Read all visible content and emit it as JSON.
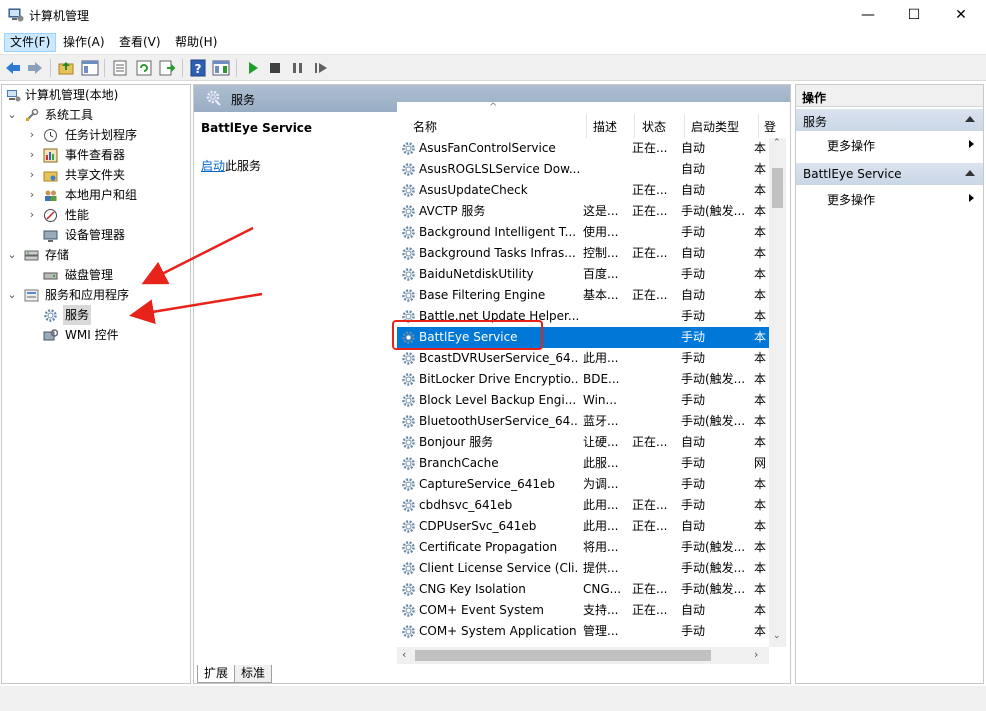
{
  "window": {
    "title": "计算机管理",
    "minimize": "—",
    "maximize": "☐",
    "close": "✕"
  },
  "menubar": {
    "items": [
      "文件(F)",
      "操作(A)",
      "查看(V)",
      "帮助(H)"
    ]
  },
  "tree": {
    "root": "计算机管理(本地)",
    "items": [
      {
        "label": "系统工具",
        "icon": "tools-icon"
      },
      {
        "label": "任务计划程序",
        "icon": "clock-icon"
      },
      {
        "label": "事件查看器",
        "icon": "event-viewer-icon"
      },
      {
        "label": "共享文件夹",
        "icon": "shared-folder-icon"
      },
      {
        "label": "本地用户和组",
        "icon": "users-icon"
      },
      {
        "label": "性能",
        "icon": "performance-icon"
      },
      {
        "label": "设备管理器",
        "icon": "device-manager-icon"
      },
      {
        "label": "存储",
        "icon": "storage-icon"
      },
      {
        "label": "磁盘管理",
        "icon": "disk-icon"
      },
      {
        "label": "服务和应用程序",
        "icon": "services-apps-icon"
      },
      {
        "label": "服务",
        "icon": "gear-icon"
      },
      {
        "label": "WMI 控件",
        "icon": "wmi-icon"
      }
    ]
  },
  "middle": {
    "header": "服务",
    "detail": {
      "service_name": "BattlEye Service",
      "start_link": "启动",
      "start_suffix": "此服务"
    },
    "columns": [
      "名称",
      "描述",
      "状态",
      "启动类型",
      "登"
    ],
    "rows": [
      {
        "name": "AsusFanControlService",
        "desc": "",
        "status": "正在...",
        "startup": "自动",
        "logon": "本"
      },
      {
        "name": "AsusROGLSLService Dow...",
        "desc": "",
        "status": "",
        "startup": "自动",
        "logon": "本"
      },
      {
        "name": "AsusUpdateCheck",
        "desc": "",
        "status": "正在...",
        "startup": "自动",
        "logon": "本"
      },
      {
        "name": "AVCTP 服务",
        "desc": "这是...",
        "status": "正在...",
        "startup": "手动(触发...",
        "logon": "本"
      },
      {
        "name": "Background Intelligent T...",
        "desc": "使用...",
        "status": "",
        "startup": "手动",
        "logon": "本"
      },
      {
        "name": "Background Tasks Infras...",
        "desc": "控制...",
        "status": "正在...",
        "startup": "自动",
        "logon": "本"
      },
      {
        "name": "BaiduNetdiskUtility",
        "desc": "百度...",
        "status": "",
        "startup": "手动",
        "logon": "本"
      },
      {
        "name": "Base Filtering Engine",
        "desc": "基本...",
        "status": "正在...",
        "startup": "自动",
        "logon": "本"
      },
      {
        "name": "Battle.net Update Helper...",
        "desc": "",
        "status": "",
        "startup": "手动",
        "logon": "本"
      },
      {
        "name": "BattlEye Service",
        "desc": "",
        "status": "",
        "startup": "手动",
        "logon": "本"
      },
      {
        "name": "BcastDVRUserService_64...",
        "desc": "此用...",
        "status": "",
        "startup": "手动",
        "logon": "本"
      },
      {
        "name": "BitLocker Drive Encryptio...",
        "desc": "BDE...",
        "status": "",
        "startup": "手动(触发...",
        "logon": "本"
      },
      {
        "name": "Block Level Backup Engi...",
        "desc": "Win...",
        "status": "",
        "startup": "手动",
        "logon": "本"
      },
      {
        "name": "BluetoothUserService_64...",
        "desc": "蓝牙...",
        "status": "",
        "startup": "手动(触发...",
        "logon": "本"
      },
      {
        "name": "Bonjour 服务",
        "desc": "让硬...",
        "status": "正在...",
        "startup": "自动",
        "logon": "本"
      },
      {
        "name": "BranchCache",
        "desc": "此服...",
        "status": "",
        "startup": "手动",
        "logon": "网"
      },
      {
        "name": "CaptureService_641eb",
        "desc": "为调...",
        "status": "",
        "startup": "手动",
        "logon": "本"
      },
      {
        "name": "cbdhsvc_641eb",
        "desc": "此用...",
        "status": "正在...",
        "startup": "手动",
        "logon": "本"
      },
      {
        "name": "CDPUserSvc_641eb",
        "desc": "此用...",
        "status": "正在...",
        "startup": "自动",
        "logon": "本"
      },
      {
        "name": "Certificate Propagation",
        "desc": "将用...",
        "status": "",
        "startup": "手动(触发...",
        "logon": "本"
      },
      {
        "name": "Client License Service (Cli...",
        "desc": "提供...",
        "status": "",
        "startup": "手动(触发...",
        "logon": "本"
      },
      {
        "name": "CNG Key Isolation",
        "desc": "CNG...",
        "status": "正在...",
        "startup": "手动(触发...",
        "logon": "本"
      },
      {
        "name": "COM+ Event System",
        "desc": "支持...",
        "status": "正在...",
        "startup": "自动",
        "logon": "本"
      },
      {
        "name": "COM+ System Application",
        "desc": "管理...",
        "status": "",
        "startup": "手动",
        "logon": "本"
      }
    ],
    "selected_index": 9,
    "tabs": [
      "扩展",
      "标准"
    ]
  },
  "actions": {
    "header": "操作",
    "sections": [
      {
        "title": "服务",
        "item": "更多操作"
      },
      {
        "title": "BattlEye Service",
        "item": "更多操作"
      }
    ]
  },
  "colors": {
    "selection": "#0078d7",
    "annotation_red": "#e8231a",
    "pane_header": "#a9bad0"
  }
}
